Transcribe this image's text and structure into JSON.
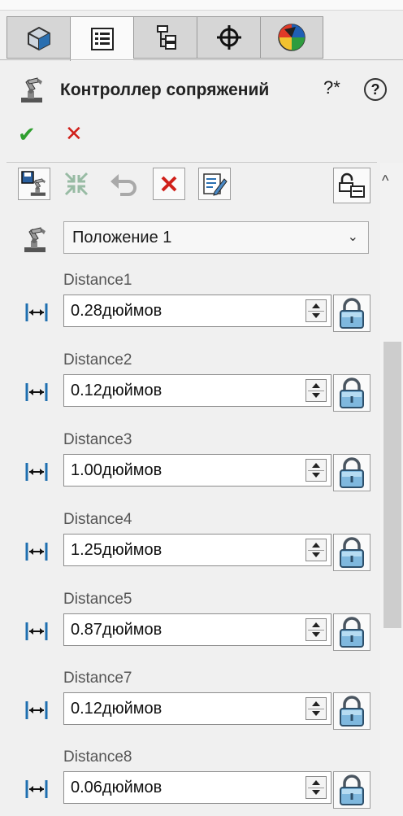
{
  "tabs": [
    {
      "name": "feature-manager",
      "icon": "part-cube-icon"
    },
    {
      "name": "property-manager",
      "icon": "property-list-icon",
      "active": true
    },
    {
      "name": "configuration-manager",
      "icon": "configuration-tree-icon"
    },
    {
      "name": "dimxpert-manager",
      "icon": "crosshair-icon"
    },
    {
      "name": "display-manager",
      "icon": "color-wheel-icon"
    }
  ],
  "header": {
    "title": "Контроллер сопряжений",
    "help_star_label": "?*",
    "help_label": "?"
  },
  "actions": {
    "ok_label": "✔",
    "cancel_label": "✕"
  },
  "toolbar": {
    "buttons": [
      "robot-save-icon",
      "collapse-arrows-icon",
      "undo-arrow-icon",
      "delete-x-icon",
      "edit-note-icon",
      "padlock-open-icon"
    ]
  },
  "position": {
    "selected": "Положение 1"
  },
  "distances": [
    {
      "label": "Distance1",
      "value": "0.28дюймов"
    },
    {
      "label": "Distance2",
      "value": "0.12дюймов"
    },
    {
      "label": "Distance3",
      "value": "1.00дюймов"
    },
    {
      "label": "Distance4",
      "value": "1.25дюймов"
    },
    {
      "label": "Distance5",
      "value": "0.87дюймов"
    },
    {
      "label": "Distance7",
      "value": "0.12дюймов"
    },
    {
      "label": "Distance8",
      "value": "0.06дюймов"
    }
  ],
  "colors": {
    "accent_blue": "#1f6fb0",
    "ok_green": "#2e9f2e",
    "cancel_red": "#d0201a"
  }
}
